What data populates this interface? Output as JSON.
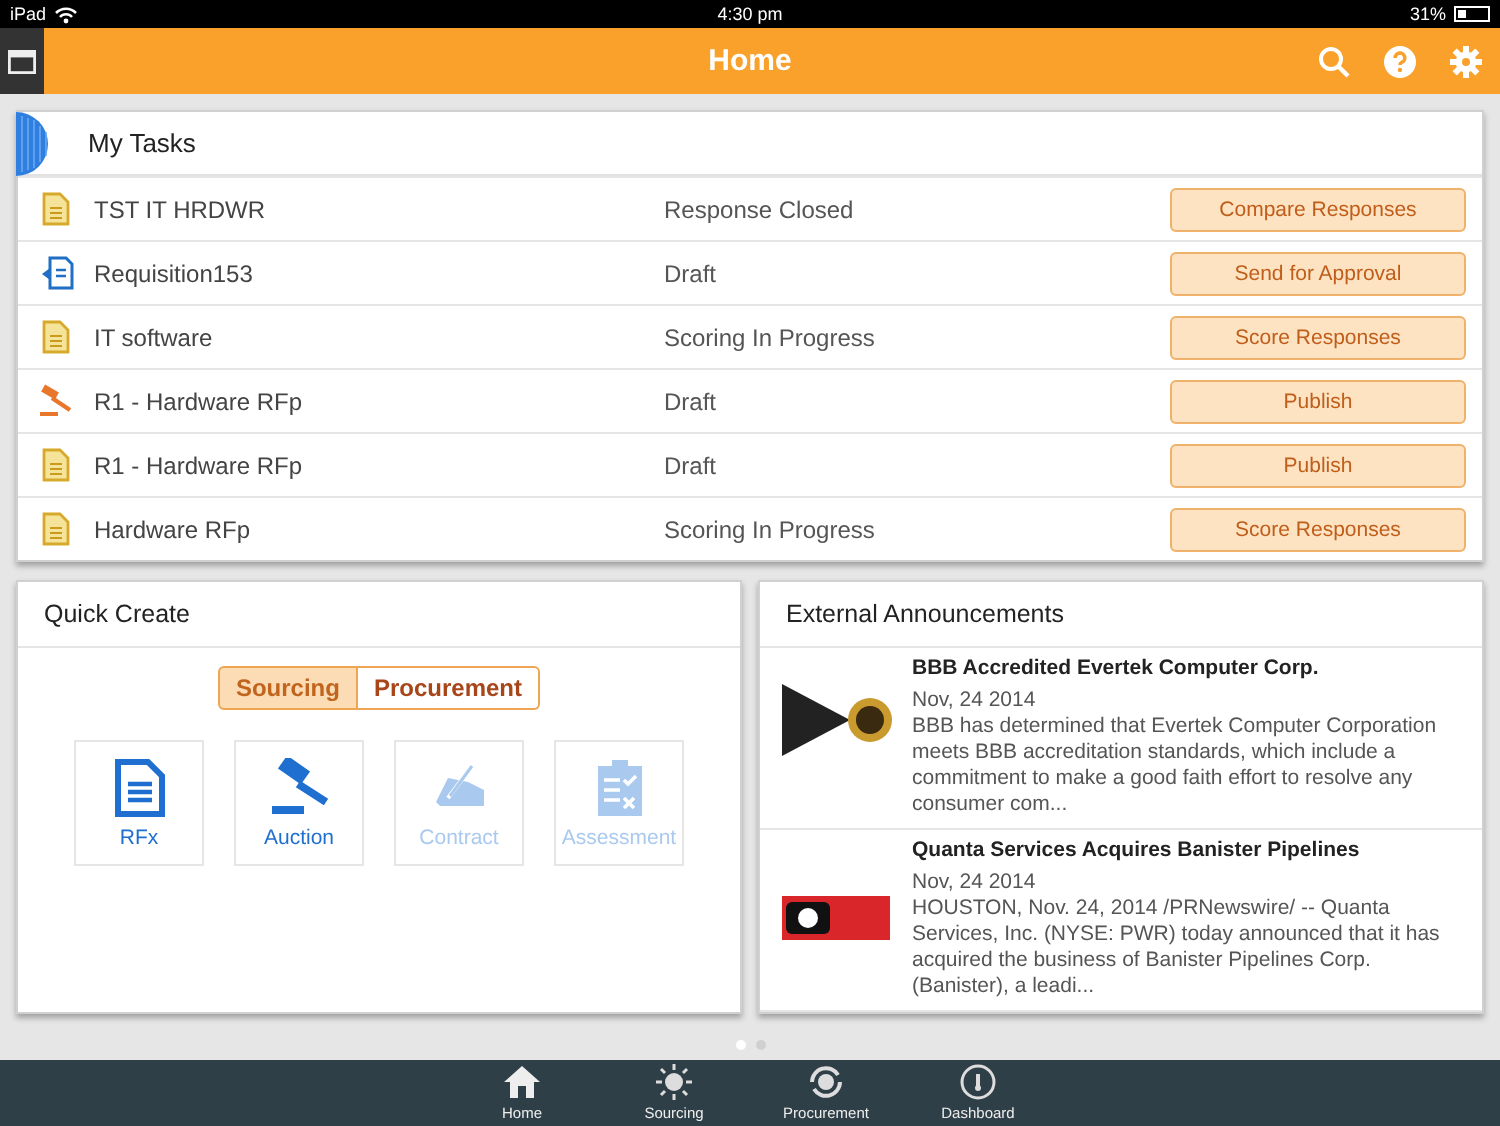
{
  "status_bar": {
    "device": "iPad",
    "time": "4:30 pm",
    "battery": "31%"
  },
  "header": {
    "title": "Home"
  },
  "my_tasks": {
    "title": "My Tasks",
    "rows": [
      {
        "kind": "document",
        "name": "TST IT HRDWR",
        "status": "Response Closed",
        "action": "Compare Responses"
      },
      {
        "kind": "requisition",
        "name": "Requisition153",
        "status": "Draft",
        "action": "Send for Approval"
      },
      {
        "kind": "document",
        "name": "IT software",
        "status": "Scoring In Progress",
        "action": "Score Responses"
      },
      {
        "kind": "auction",
        "name": "R1 - Hardware RFp",
        "status": "Draft",
        "action": "Publish"
      },
      {
        "kind": "document",
        "name": "R1 - Hardware RFp",
        "status": "Draft",
        "action": "Publish"
      },
      {
        "kind": "document",
        "name": "Hardware RFp",
        "status": "Scoring In Progress",
        "action": "Score Responses"
      }
    ]
  },
  "quick_create": {
    "title": "Quick Create",
    "segments": [
      {
        "label": "Sourcing",
        "selected": true
      },
      {
        "label": "Procurement",
        "selected": false
      }
    ],
    "items": [
      {
        "kind": "rfx",
        "label": "RFx",
        "disabled": false
      },
      {
        "kind": "auction",
        "label": "Auction",
        "disabled": false
      },
      {
        "kind": "contract",
        "label": "Contract",
        "disabled": true
      },
      {
        "kind": "assessment",
        "label": "Assessment",
        "disabled": true
      }
    ]
  },
  "external_announcements": {
    "title": "External Announcements",
    "items": [
      {
        "kind": "badge",
        "headline": "BBB Accredited Evertek Computer Corp.",
        "date": "Nov, 24 2014",
        "summary": "BBB has determined that Evertek Computer Corporation meets BBB accreditation standards, which include a commitment to make a good faith effort to resolve any consumer com..."
      },
      {
        "kind": "banner",
        "headline": "Quanta Services Acquires Banister Pipelines",
        "date": "Nov, 24 2014",
        "summary": "HOUSTON, Nov. 24, 2014 /PRNewswire/ -- Quanta Services, Inc. (NYSE: PWR) today announced that it has acquired the business of Banister Pipelines Corp. (Banister), a leadi..."
      }
    ]
  },
  "page_dots": [
    {
      "selected": true
    },
    {
      "selected": false
    }
  ],
  "tab_bar": [
    {
      "kind": "home",
      "label": "Home"
    },
    {
      "kind": "sourcing",
      "label": "Sourcing"
    },
    {
      "kind": "procurement",
      "label": "Procurement"
    },
    {
      "kind": "dashboard",
      "label": "Dashboard"
    }
  ]
}
